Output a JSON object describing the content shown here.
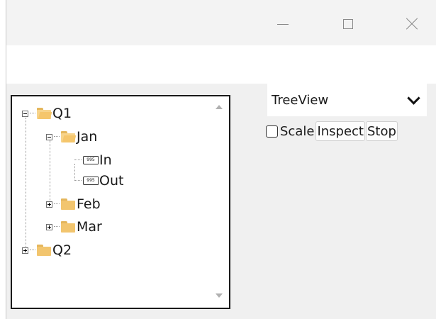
{
  "window": {
    "caption_buttons": {
      "minimize": "minimize-icon",
      "maximize": "maximize-icon",
      "close": "close-icon"
    }
  },
  "tree": {
    "nodes": [
      {
        "label": "Q1",
        "icon": "folder-open-icon",
        "expanded": true
      },
      {
        "label": "Jan",
        "icon": "folder-open-icon",
        "expanded": true
      },
      {
        "label": "In",
        "icon": "tag-icon",
        "tag_text": "995"
      },
      {
        "label": "Out",
        "icon": "tag-icon",
        "tag_text": "995"
      },
      {
        "label": "Feb",
        "icon": "folder-icon",
        "expanded": false
      },
      {
        "label": "Mar",
        "icon": "folder-icon",
        "expanded": false
      },
      {
        "label": "Q2",
        "icon": "folder-icon",
        "expanded": false
      }
    ]
  },
  "controls": {
    "view_select": {
      "value": "TreeView"
    },
    "scale_checkbox": {
      "label": "Scale",
      "checked": false
    },
    "inspect_button": "Inspect",
    "stop_button": "Stop"
  },
  "colors": {
    "folder": "#f2c56e",
    "panel_border": "#1a1a1a",
    "background": "#f0f0f0"
  }
}
